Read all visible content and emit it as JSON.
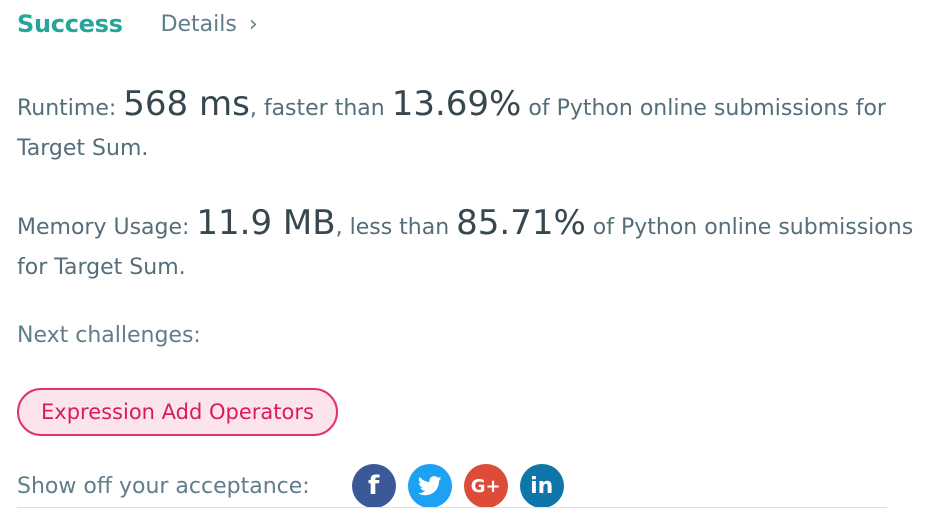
{
  "header": {
    "status": "Success",
    "details_label": "Details",
    "chevron": "›"
  },
  "runtime": {
    "label": "Runtime: ",
    "value": "568 ms",
    "mid": ", faster than ",
    "percent": "13.69%",
    "tail": " of Python online submissions for Target Sum."
  },
  "memory": {
    "label": "Memory Usage: ",
    "value": "11.9 MB",
    "mid": ", less than ",
    "percent": "85.71%",
    "tail": " of Python online submissions for Target Sum."
  },
  "next": {
    "label": "Next challenges:",
    "challenges": [
      "Expression Add Operators"
    ]
  },
  "share": {
    "label": "Show off your acceptance:",
    "icons": [
      {
        "name": "facebook-icon",
        "glyph": "f",
        "color": "#3b5998"
      },
      {
        "name": "twitter-icon",
        "glyph": "",
        "color": "#1da1f2"
      },
      {
        "name": "google-plus-icon",
        "glyph": "G+",
        "color": "#dd4b39"
      },
      {
        "name": "linkedin-icon",
        "glyph": "in",
        "color": "#0e76a8"
      }
    ]
  },
  "colors": {
    "accent": "#26a69a",
    "challenge_border": "#e0336e",
    "challenge_bg": "#fce4ec"
  }
}
